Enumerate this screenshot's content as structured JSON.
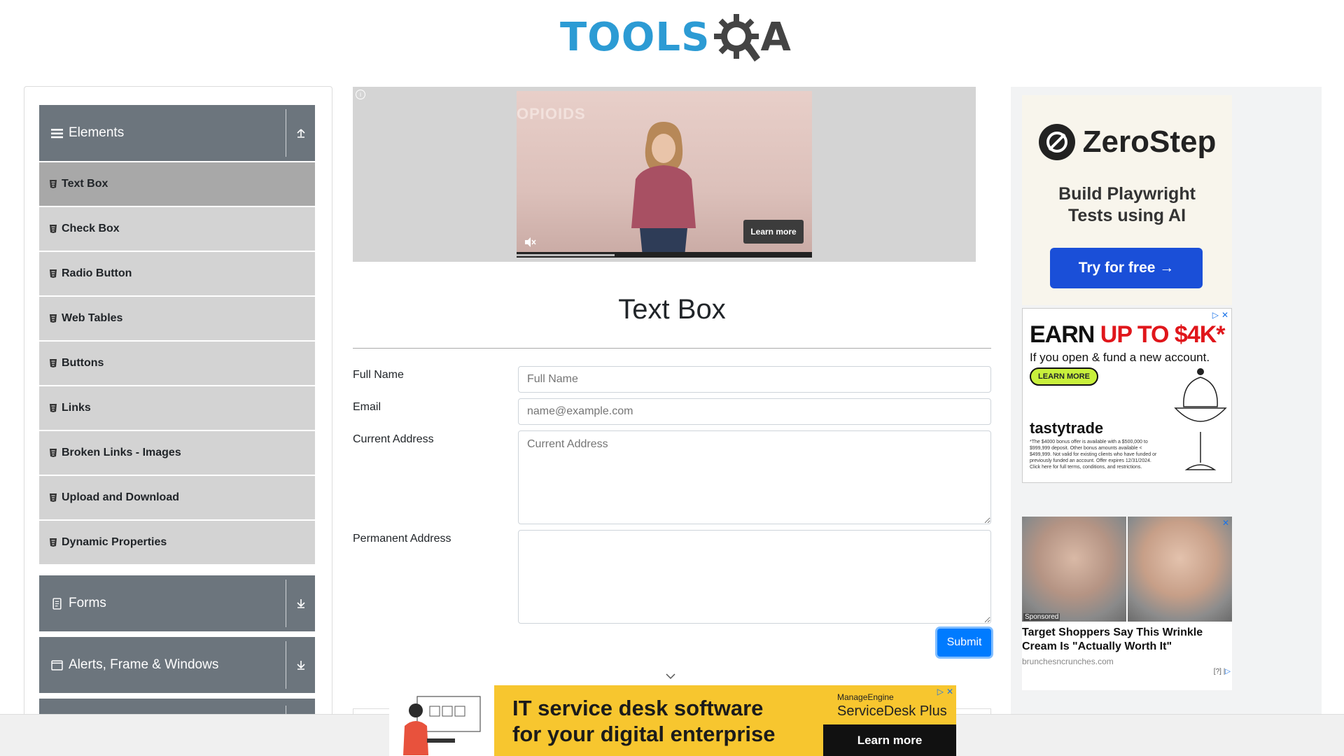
{
  "header": {
    "logo_tools": "TOOLS",
    "logo_qa": "A"
  },
  "sidebar": {
    "groups": [
      {
        "label": "Elements",
        "icon": "hamburger-icon",
        "toggle_icon": "collapse-up-icon",
        "expanded": true
      },
      {
        "label": "Forms",
        "icon": "document-icon",
        "toggle_icon": "expand-down-icon",
        "expanded": false
      },
      {
        "label": "Alerts, Frame & Windows",
        "icon": "window-icon",
        "toggle_icon": "expand-down-icon",
        "expanded": false
      }
    ],
    "items": [
      {
        "label": "Text Box",
        "active": true
      },
      {
        "label": "Check Box"
      },
      {
        "label": "Radio Button"
      },
      {
        "label": "Web Tables"
      },
      {
        "label": "Buttons"
      },
      {
        "label": "Links"
      },
      {
        "label": "Broken Links - Images"
      },
      {
        "label": "Upload and Download"
      },
      {
        "label": "Dynamic Properties"
      }
    ]
  },
  "video_ad": {
    "overlay_text": "OPIOIDS",
    "learn_more": "Learn more",
    "info": "i"
  },
  "main": {
    "title": "Text Box",
    "fields": {
      "full_name": {
        "label": "Full Name",
        "placeholder": "Full Name"
      },
      "email": {
        "label": "Email",
        "placeholder": "name@example.com"
      },
      "current_address": {
        "label": "Current Address",
        "placeholder": "Current Address"
      },
      "permanent_address": {
        "label": "Permanent Address",
        "placeholder": ""
      }
    },
    "submit_label": "Submit"
  },
  "ads": {
    "zerostep": {
      "brand": "ZeroStep",
      "tagline_1": "Build Playwright",
      "tagline_2": "Tests using AI",
      "cta": "Try for free →"
    },
    "tastytrade": {
      "earn": "EARN ",
      "earn_highlight": "UP TO $4K*",
      "sub": "If you open & fund a new account.",
      "cta": "LEARN MORE",
      "brand": "tastytrade",
      "fine_print": "*The $4000 bonus offer is available with a $500,000 to $999,999 deposit. Other bonus amounts available < $499,999. Not valid for existing clients who have funded or previously funded an account. Offer expires 12/31/2024. Click here for full terms, conditions, and restrictions."
    },
    "sponsored": {
      "tag": "Sponsored",
      "title": "Target Shoppers Say This Wrinkle Cream Is \"Actually Worth It\"",
      "source": "brunchesncrunches.com",
      "info": "[?] |"
    },
    "bottom": {
      "headline_1": "IT service desk software",
      "headline_2": "for your digital enterprise",
      "brand": "ManageEngine",
      "product": "ServiceDesk Plus",
      "cta": "Learn more"
    }
  },
  "colors": {
    "accent": "#007bff",
    "sidebar_header": "#6c757d",
    "menu_item": "#d3d3d3",
    "menu_active": "#a8a8a8"
  }
}
